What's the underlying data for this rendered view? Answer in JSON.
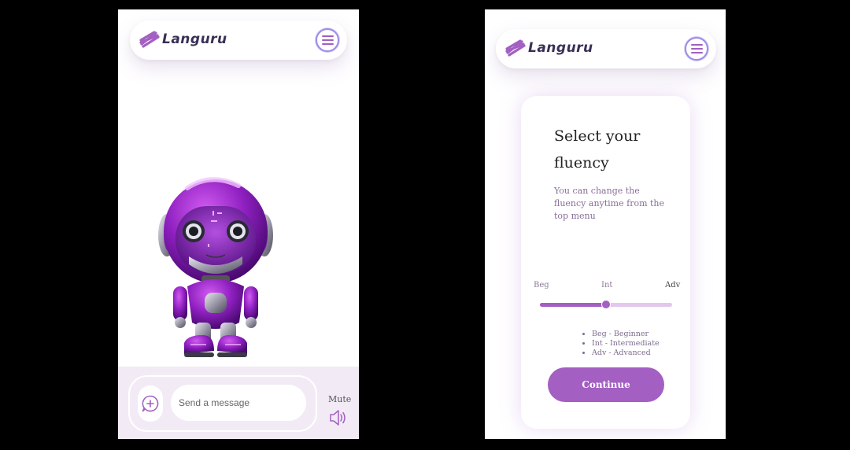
{
  "app": {
    "logo_text": "Languru"
  },
  "chat": {
    "placeholder": "Send a message",
    "mute_label": "Mute"
  },
  "fluency": {
    "title": "Select your fluency",
    "subtitle": "You can change the fluency anytime from the top menu",
    "levels": [
      "Beg",
      "Int",
      "Adv"
    ],
    "selected_position": 0.5,
    "legend": [
      "Beg - Beginner",
      "Int - Intermediate",
      "Adv - Advanced"
    ],
    "continue_label": "Continue"
  },
  "colors": {
    "accent": "#a35fc2",
    "chat_bar_bg": "#f2ebf6",
    "logo_text": "#3a2f56"
  },
  "icons": {
    "logo": "brush-stroke-logo",
    "menu": "hamburger-menu-icon",
    "add": "add-chat-icon",
    "speaker": "speaker-icon"
  }
}
